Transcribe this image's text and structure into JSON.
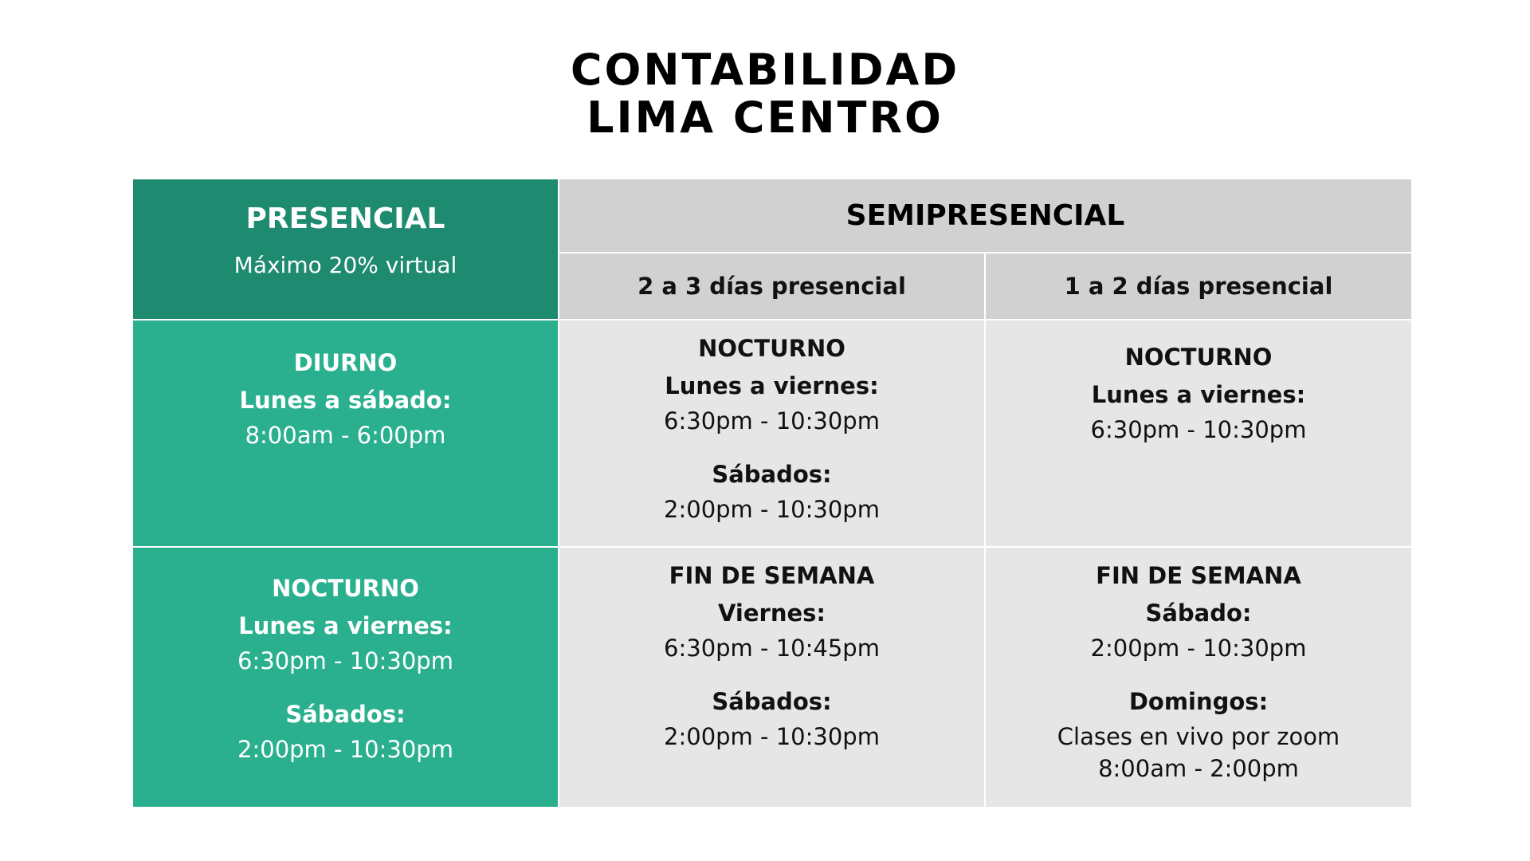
{
  "title": {
    "line1": "CONTABILIDAD",
    "line2": "LIMA CENTRO"
  },
  "header": {
    "presencial": {
      "label": "PRESENCIAL",
      "note": "Máximo 20% virtual"
    },
    "semipresencial": {
      "label": "SEMIPRESENCIAL",
      "col1": "2 a 3 días presencial",
      "col2": "1 a 2 días presencial"
    }
  },
  "rows": [
    {
      "presencial": {
        "turno": "DIURNO",
        "dias": "Lunes a sábado:",
        "horario": "8:00am - 6:00pm"
      },
      "semi_2a3": {
        "turno": "NOCTURNO",
        "dias1": "Lunes a viernes:",
        "horario1": "6:30pm - 10:30pm",
        "dias2": "Sábados:",
        "horario2": "2:00pm - 10:30pm"
      },
      "semi_1a2": {
        "turno": "NOCTURNO",
        "dias": "Lunes a viernes:",
        "horario": "6:30pm - 10:30pm"
      }
    },
    {
      "presencial": {
        "turno": "NOCTURNO",
        "dias1": "Lunes a viernes:",
        "horario1": "6:30pm - 10:30pm",
        "dias2": "Sábados:",
        "horario2": "2:00pm - 10:30pm"
      },
      "semi_2a3": {
        "turno": "FIN DE SEMANA",
        "dias1": "Viernes:",
        "horario1": "6:30pm - 10:45pm",
        "dias2": "Sábados:",
        "horario2": "2:00pm - 10:30pm"
      },
      "semi_1a2": {
        "turno": "FIN DE SEMANA",
        "dias1": "Sábado:",
        "horario1": "2:00pm - 10:30pm",
        "dias2": "Domingos:",
        "detalle2": "Clases en vivo por zoom",
        "horario2": "8:00am - 2:00pm"
      }
    }
  ],
  "colors": {
    "presencial_header": "#1e8a6f",
    "presencial_body": "#2bb08f",
    "semi_header": "#d1d1d1",
    "semi_body": "#e6e6e6"
  }
}
